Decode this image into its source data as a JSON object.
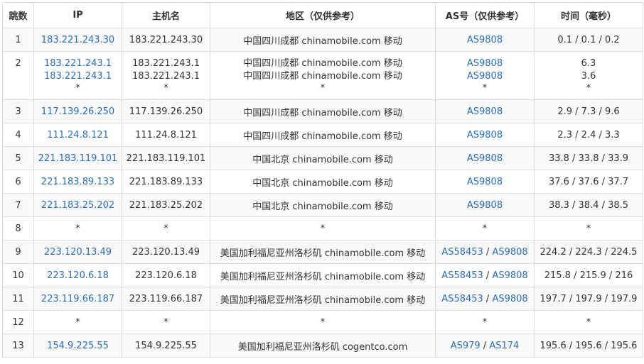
{
  "columns": [
    "跳数",
    "IP",
    "主机名",
    "地区（仅供参考）",
    "AS号（仅供参考）",
    "时间（毫秒）"
  ],
  "rows": [
    {
      "hop": "1",
      "ip": [
        "183.221.243.30"
      ],
      "host": [
        "183.221.243.30"
      ],
      "region": [
        "中国四川成都 chinamobile.com 移动"
      ],
      "as": [
        [
          "AS9808"
        ]
      ],
      "time": [
        "0.1 / 0.1 / 0.2"
      ]
    },
    {
      "hop": "2",
      "ip": [
        "183.221.243.1",
        "183.221.243.1",
        "*"
      ],
      "host": [
        "183.221.243.1",
        "183.221.243.1",
        "*"
      ],
      "region": [
        "中国四川成都 chinamobile.com 移动",
        "中国四川成都 chinamobile.com 移动",
        "*"
      ],
      "as": [
        [
          "AS9808"
        ],
        [
          "AS9808"
        ],
        [
          "*"
        ]
      ],
      "time": [
        "6.3",
        "3.6",
        "*"
      ]
    },
    {
      "hop": "3",
      "ip": [
        "117.139.26.250"
      ],
      "host": [
        "117.139.26.250"
      ],
      "region": [
        "中国四川成都 chinamobile.com 移动"
      ],
      "as": [
        [
          "AS9808"
        ]
      ],
      "time": [
        "2.9 / 7.3 / 9.6"
      ]
    },
    {
      "hop": "4",
      "ip": [
        "111.24.8.121"
      ],
      "host": [
        "111.24.8.121"
      ],
      "region": [
        "中国四川成都 chinamobile.com 移动"
      ],
      "as": [
        [
          "AS9808"
        ]
      ],
      "time": [
        "2.3 / 2.4 / 3.3"
      ]
    },
    {
      "hop": "5",
      "ip": [
        "221.183.119.101"
      ],
      "host": [
        "221.183.119.101"
      ],
      "region": [
        "中国北京 chinamobile.com 移动"
      ],
      "as": [
        [
          "AS9808"
        ]
      ],
      "time": [
        "33.8 / 33.8 / 33.9"
      ]
    },
    {
      "hop": "6",
      "ip": [
        "221.183.89.133"
      ],
      "host": [
        "221.183.89.133"
      ],
      "region": [
        "中国北京 chinamobile.com 移动"
      ],
      "as": [
        [
          "AS9808"
        ]
      ],
      "time": [
        "37.6 / 37.6 / 37.7"
      ]
    },
    {
      "hop": "7",
      "ip": [
        "221.183.25.202"
      ],
      "host": [
        "221.183.25.202"
      ],
      "region": [
        "中国北京 chinamobile.com 移动"
      ],
      "as": [
        [
          "AS9808"
        ]
      ],
      "time": [
        "38.3 / 38.4 / 38.5"
      ]
    },
    {
      "hop": "8",
      "ip": [
        "*"
      ],
      "host": [
        "*"
      ],
      "region": [
        "*"
      ],
      "as": [
        [
          "*"
        ]
      ],
      "time": [
        "*"
      ]
    },
    {
      "hop": "9",
      "ip": [
        "223.120.13.49"
      ],
      "host": [
        "223.120.13.49"
      ],
      "region": [
        "美国加利福尼亚州洛杉矶 chinamobile.com 移动"
      ],
      "as": [
        [
          "AS58453",
          "AS9808"
        ]
      ],
      "time": [
        "224.2 / 224.3 / 224.5"
      ]
    },
    {
      "hop": "10",
      "ip": [
        "223.120.6.18"
      ],
      "host": [
        "223.120.6.18"
      ],
      "region": [
        "美国加利福尼亚州洛杉矶 chinamobile.com 移动"
      ],
      "as": [
        [
          "AS58453",
          "AS9808"
        ]
      ],
      "time": [
        "215.8 / 215.9 / 216"
      ]
    },
    {
      "hop": "11",
      "ip": [
        "223.119.66.187"
      ],
      "host": [
        "223.119.66.187"
      ],
      "region": [
        "美国加利福尼亚州洛杉矶 chinamobile.com 移动"
      ],
      "as": [
        [
          "AS58453",
          "AS9808"
        ]
      ],
      "time": [
        "197.7 / 197.9 / 197.9"
      ]
    },
    {
      "hop": "12",
      "ip": [
        "*"
      ],
      "host": [
        "*"
      ],
      "region": [
        "*"
      ],
      "as": [
        [
          "*"
        ]
      ],
      "time": [
        "*"
      ]
    },
    {
      "hop": "13",
      "ip": [
        "154.9.225.55"
      ],
      "host": [
        "154.9.225.55"
      ],
      "region": [
        "美国加利福尼亚州洛杉矶 cogentco.com"
      ],
      "as": [
        [
          "AS979",
          "AS174"
        ]
      ],
      "time": [
        "195.6 / 195.6 / 195.6"
      ]
    }
  ],
  "colors": {
    "link": "#2a6ebb",
    "border": "#dddddd",
    "stripe": "#f9f9f9"
  }
}
